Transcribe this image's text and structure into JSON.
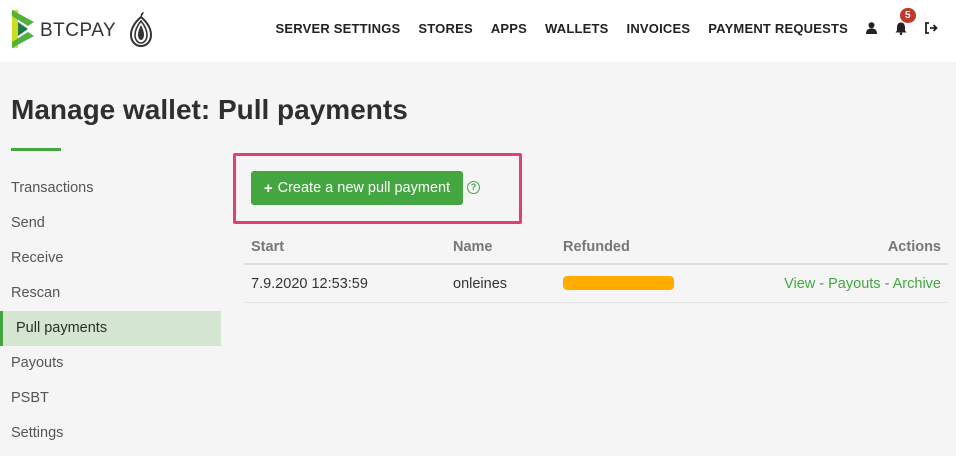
{
  "brand": {
    "name": "BTCPAY",
    "accent": "#44a641"
  },
  "nav": {
    "items": [
      "SERVER SETTINGS",
      "STORES",
      "APPS",
      "WALLETS",
      "INVOICES",
      "PAYMENT REQUESTS"
    ],
    "notifications_count": "5",
    "icons": [
      "user-icon",
      "bell-icon",
      "logout-icon"
    ]
  },
  "page": {
    "title": "Manage wallet: Pull payments"
  },
  "sidebar": {
    "items": [
      {
        "label": "Transactions",
        "active": false
      },
      {
        "label": "Send",
        "active": false
      },
      {
        "label": "Receive",
        "active": false
      },
      {
        "label": "Rescan",
        "active": false
      },
      {
        "label": "Pull payments",
        "active": true
      },
      {
        "label": "Payouts",
        "active": false
      },
      {
        "label": "PSBT",
        "active": false
      },
      {
        "label": "Settings",
        "active": false
      }
    ]
  },
  "main": {
    "create_button_label": "Create a new pull payment",
    "help_icon": "question-circle-icon",
    "table": {
      "headers": {
        "start": "Start",
        "name": "Name",
        "refunded": "Refunded",
        "actions": "Actions"
      },
      "rows": [
        {
          "start": "7.9.2020 12:53:59",
          "name": "onleines",
          "refunded_progress": 1.0,
          "refunded_color": "#ffab00",
          "actions": {
            "view": "View",
            "payouts": "Payouts",
            "archive": "Archive",
            "separator": " - "
          }
        }
      ]
    }
  },
  "highlight_color": "#e03f7a"
}
